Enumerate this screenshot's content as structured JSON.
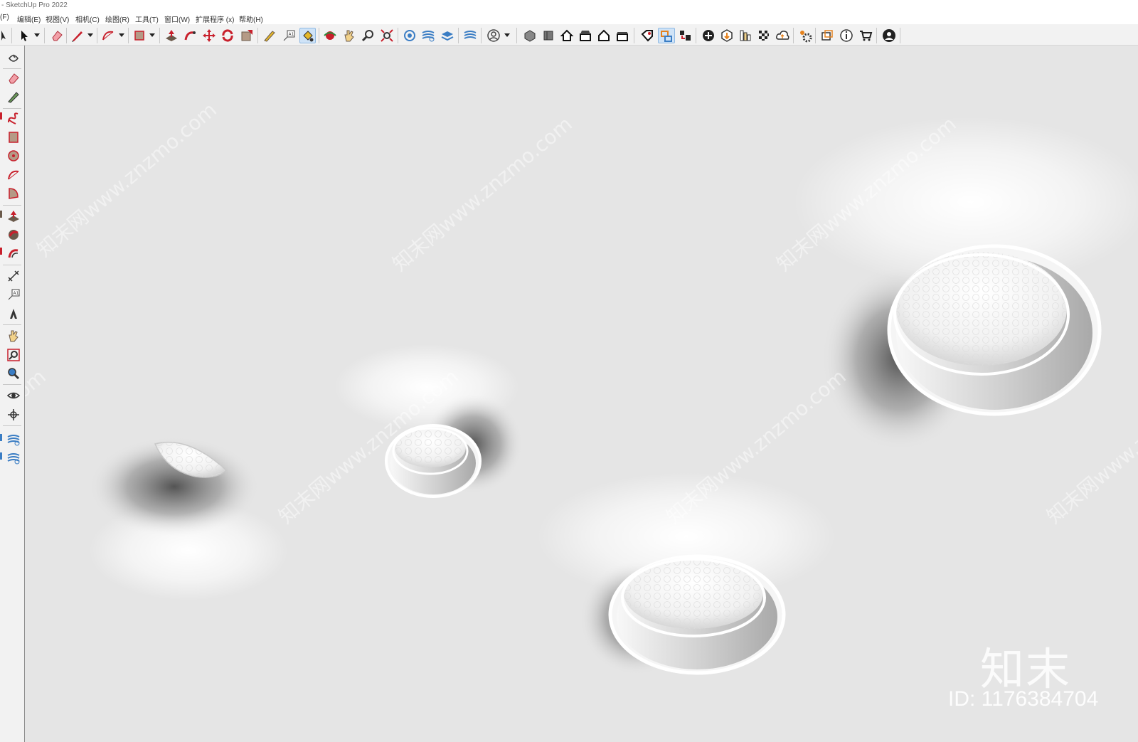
{
  "window": {
    "title": "- SketchUp Pro 2022"
  },
  "menu": {
    "items": [
      "(F)",
      "编辑(E)",
      "视图(V)",
      "相机(C)",
      "绘图(R)",
      "工具(T)",
      "窗口(W)",
      "扩展程序 (x)",
      "帮助(H)"
    ]
  },
  "toolbar": {
    "icons": [
      "select-icon",
      "eraser-icon",
      "pencil-line-icon",
      "arc-icon",
      "rectangle-icon",
      "push-pull-icon",
      "follow-me-icon",
      "move-icon",
      "rotate-icon",
      "scale-icon",
      "tape-measure-icon",
      "text-icon",
      "paint-bucket-icon",
      "orbit-icon",
      "pan-icon",
      "zoom-icon",
      "zoom-extents-icon",
      "section-plane-icon",
      "sandbox-icon",
      "layers-icon",
      "extension-icon",
      "user-icon",
      "iso-view-icon",
      "top-view-icon",
      "front-view-icon",
      "right-view-icon",
      "back-view-icon",
      "left-view-icon",
      "tag-icon",
      "styles-icon",
      "components-icon",
      "add-location-icon",
      "solid-tools-icon",
      "outliner-icon",
      "texture-icon",
      "cloud-icon",
      "settings-icon",
      "scenes-icon",
      "info-icon",
      "cart-icon",
      "account-icon"
    ],
    "accent": "#3a7dc4",
    "red_accent": "#c8202c"
  },
  "left_toolbar": {
    "icons": [
      "orbit-icon",
      "eraser-icon",
      "paint-icon",
      "freehand-icon",
      "rectangle-icon",
      "circle-icon",
      "arc-icon",
      "pie-icon",
      "push-pull-icon",
      "follow-me-icon",
      "offset-icon",
      "dimension-icon",
      "label-icon",
      "three-d-text-icon",
      "pan-icon",
      "zoom-window-icon",
      "zoom-extents-icon",
      "look-around-icon",
      "walk-icon",
      "sandbox-from-contours-icon",
      "sandbox-smoove-icon"
    ]
  },
  "viewport": {
    "background": "#e5e5e5",
    "watermark_text": "知末网www.znzmo.com",
    "watermark_logo": "知末",
    "watermark_id": "ID: 1176384704"
  }
}
